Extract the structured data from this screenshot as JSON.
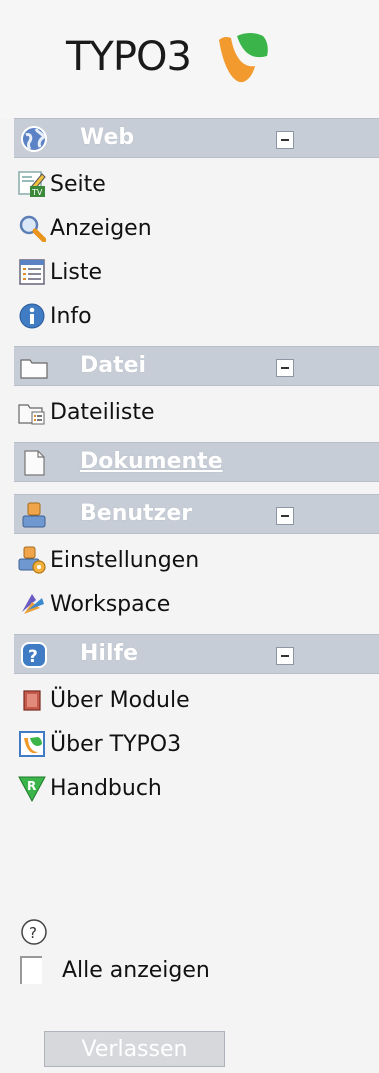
{
  "logo": {
    "text": "TYPO3"
  },
  "sections": [
    {
      "title": "Web",
      "collapse": true,
      "items": [
        {
          "label": "Seite",
          "icon": "page-tv-icon"
        },
        {
          "label": "Anzeigen",
          "icon": "magnifier-icon"
        },
        {
          "label": "Liste",
          "icon": "list-icon"
        },
        {
          "label": "Info",
          "icon": "info-icon"
        }
      ]
    },
    {
      "title": "Datei",
      "collapse": true,
      "items": [
        {
          "label": "Dateiliste",
          "icon": "filelist-icon"
        }
      ]
    },
    {
      "title": "Dokumente",
      "collapse": false,
      "link": true,
      "items": []
    },
    {
      "title": "Benutzer",
      "collapse": true,
      "items": [
        {
          "label": "Einstellungen",
          "icon": "user-settings-icon"
        },
        {
          "label": "Workspace",
          "icon": "workspace-icon"
        }
      ]
    },
    {
      "title": "Hilfe",
      "collapse": true,
      "items": [
        {
          "label": "Über Module",
          "icon": "book-icon"
        },
        {
          "label": "Über TYPO3",
          "icon": "typo3-icon"
        },
        {
          "label": "Handbuch",
          "icon": "manual-icon"
        }
      ]
    }
  ],
  "bottom": {
    "show_all_label": "Alle anzeigen",
    "exit_label": "Verlassen"
  },
  "colors": {
    "header_bg": "#c7cdd6",
    "logo_orange": "#f29a2e",
    "logo_green": "#3bb54a"
  }
}
